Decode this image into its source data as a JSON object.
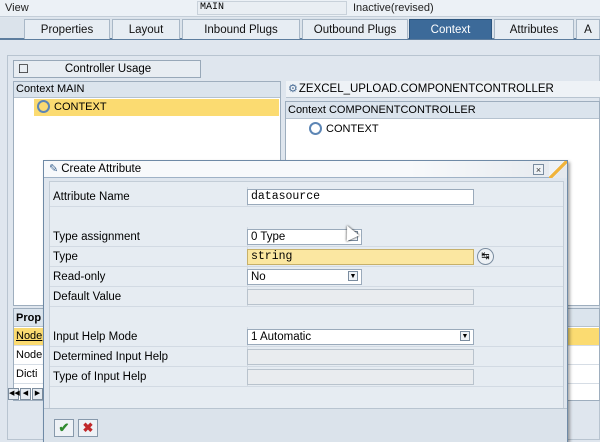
{
  "header": {
    "view_label": "View",
    "view_value": "MAIN",
    "status": "Inactive(revised)"
  },
  "tabs": [
    {
      "label": "Properties"
    },
    {
      "label": "Layout"
    },
    {
      "label": "Inbound Plugs"
    },
    {
      "label": "Outbound Plugs"
    },
    {
      "label": "Context",
      "active": true
    },
    {
      "label": "Attributes"
    },
    {
      "label": "A"
    }
  ],
  "left_panel": {
    "controller_usage_button": "Controller Usage",
    "context_header": "Context MAIN",
    "context_node": "CONTEXT"
  },
  "right_panel": {
    "component_title": "ZEXCEL_UPLOAD.COMPONENTCONTROLLER",
    "context_header": "Context COMPONENTCONTROLLER",
    "context_node": "CONTEXT"
  },
  "properties": {
    "header": "Prop",
    "rows": [
      "Node",
      "Node",
      "Dicti"
    ]
  },
  "dialog": {
    "title": "Create Attribute",
    "fields": {
      "attribute_name": {
        "label": "Attribute Name",
        "value": "datasource"
      },
      "type_assignment": {
        "label": "Type assignment",
        "value": "0 Type"
      },
      "type": {
        "label": "Type",
        "value": "string"
      },
      "read_only": {
        "label": "Read-only",
        "value": "No"
      },
      "default_value": {
        "label": "Default Value",
        "value": ""
      },
      "input_help_mode": {
        "label": "Input Help Mode",
        "value": "1 Automatic"
      },
      "determined_input_help": {
        "label": "Determined Input Help",
        "value": ""
      },
      "type_of_input_help": {
        "label": "Type of Input Help",
        "value": ""
      }
    },
    "ok_icon": "check-icon",
    "cancel_icon": "cancel-x-icon"
  },
  "colors": {
    "active_tab": "#3c6a99",
    "selection": "#fbdb71",
    "ok_green": "#2f8a2f",
    "cancel_red": "#c0282a"
  }
}
